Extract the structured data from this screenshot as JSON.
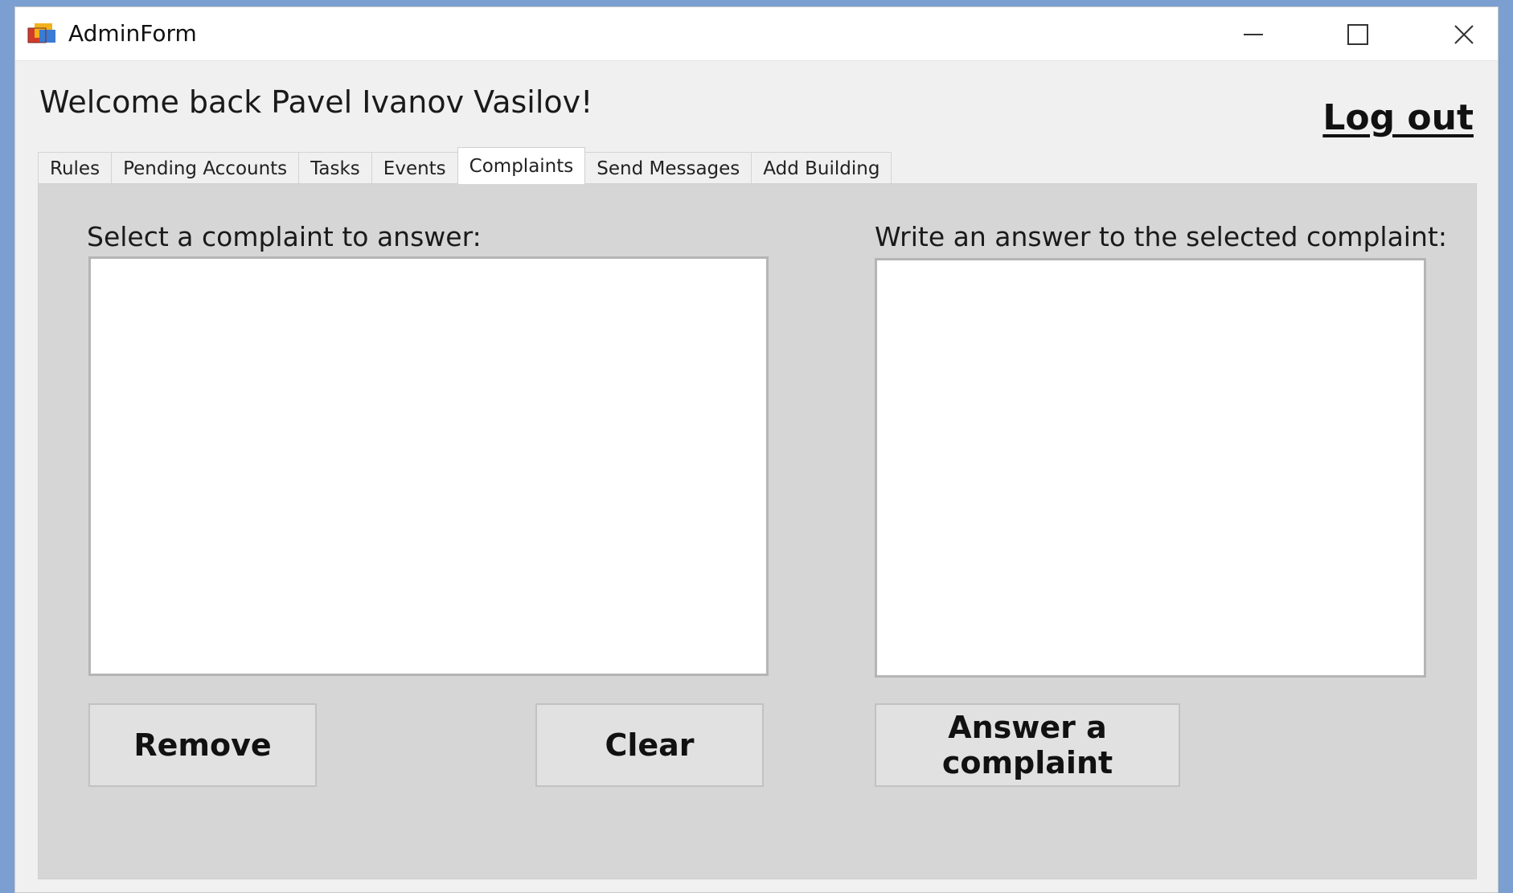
{
  "window": {
    "title": "AdminForm",
    "controls": {
      "minimize_icon": "minimize-icon",
      "maximize_icon": "maximize-icon",
      "close_icon": "close-icon"
    }
  },
  "header": {
    "welcome_text": "Welcome back Pavel Ivanov Vasilov!",
    "logout_label": "Log out"
  },
  "tabs": [
    {
      "label": "Rules",
      "active": false
    },
    {
      "label": "Pending Accounts",
      "active": false
    },
    {
      "label": "Tasks",
      "active": false
    },
    {
      "label": "Events",
      "active": false
    },
    {
      "label": "Complaints",
      "active": true
    },
    {
      "label": "Send Messages",
      "active": false
    },
    {
      "label": "Add Building",
      "active": false
    }
  ],
  "complaints": {
    "select_label": "Select a complaint to answer:",
    "answer_label": "Write an answer to the selected complaint:",
    "complaint_items": [],
    "answer_value": "",
    "remove_label": "Remove",
    "clear_label": "Clear",
    "answer_button_label": "Answer a\ncomplaint"
  },
  "colors": {
    "desktop": "#7b9fd0",
    "window_bg": "#f0f0f0",
    "panel_bg": "#d6d6d6",
    "button_bg": "#e1e1e1"
  }
}
